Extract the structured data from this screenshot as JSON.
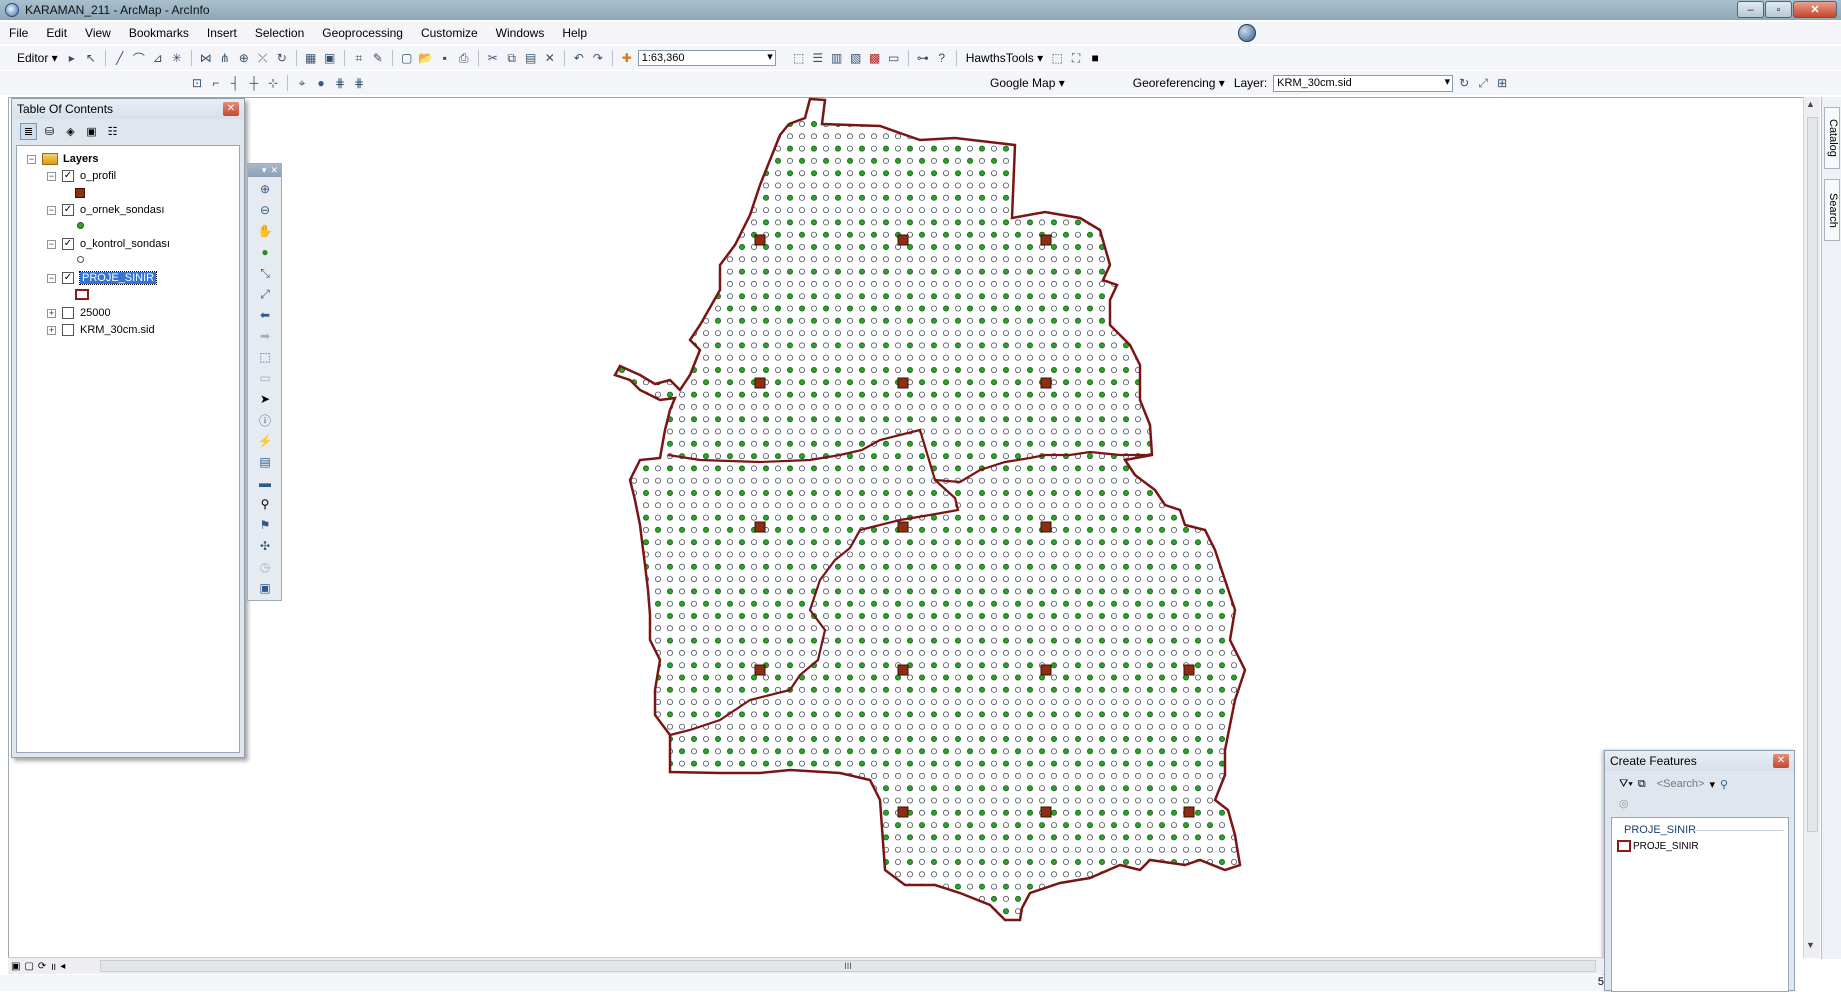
{
  "window": {
    "title": "KARAMAN_211 - ArcMap - ArcInfo",
    "min_label": "–",
    "max_label": "▫",
    "close_label": "✕"
  },
  "menu": [
    "File",
    "Edit",
    "View",
    "Bookmarks",
    "Insert",
    "Selection",
    "Geoprocessing",
    "Customize",
    "Windows",
    "Help"
  ],
  "toolbar": {
    "editor_label": "Editor ▾",
    "scale_value": "1:63,360",
    "hawths_label": "HawthsTools ▾",
    "google_map_label": "Google Map ▾",
    "georef_label": "Georeferencing ▾",
    "layer_label": "Layer:",
    "layer_value": "KRM_30cm.sid"
  },
  "toc": {
    "title": "Table Of Contents",
    "close_label": "✕",
    "root": "Layers",
    "layers": [
      {
        "name": "o_profil",
        "checked": true,
        "symbol": "brown-square"
      },
      {
        "name": "o_ornek_sondası",
        "checked": true,
        "symbol": "green-dot"
      },
      {
        "name": "o_kontrol_sondası",
        "checked": true,
        "symbol": "white-dot"
      },
      {
        "name": "PROJE_SINIR",
        "checked": true,
        "symbol": "red-outline",
        "selected": true
      },
      {
        "name": "25000",
        "checked": false
      },
      {
        "name": "KRM_30cm.sid",
        "checked": false
      }
    ],
    "checkmark": "✓",
    "minus": "−",
    "plus": "+"
  },
  "side_tabs": [
    "Catalog",
    "Search"
  ],
  "create_features": {
    "title": "Create Features",
    "close_label": "✕",
    "search_placeholder": "<Search>",
    "group": "PROJE_SINIR",
    "template": "PROJE_SINIR"
  },
  "map": {
    "boundary_color": "#7a1515",
    "green_color": "#2aa52a",
    "profile_color": "#8b2e12"
  },
  "bottom": {
    "scroll_mark": "III",
    "status_right": "5"
  }
}
